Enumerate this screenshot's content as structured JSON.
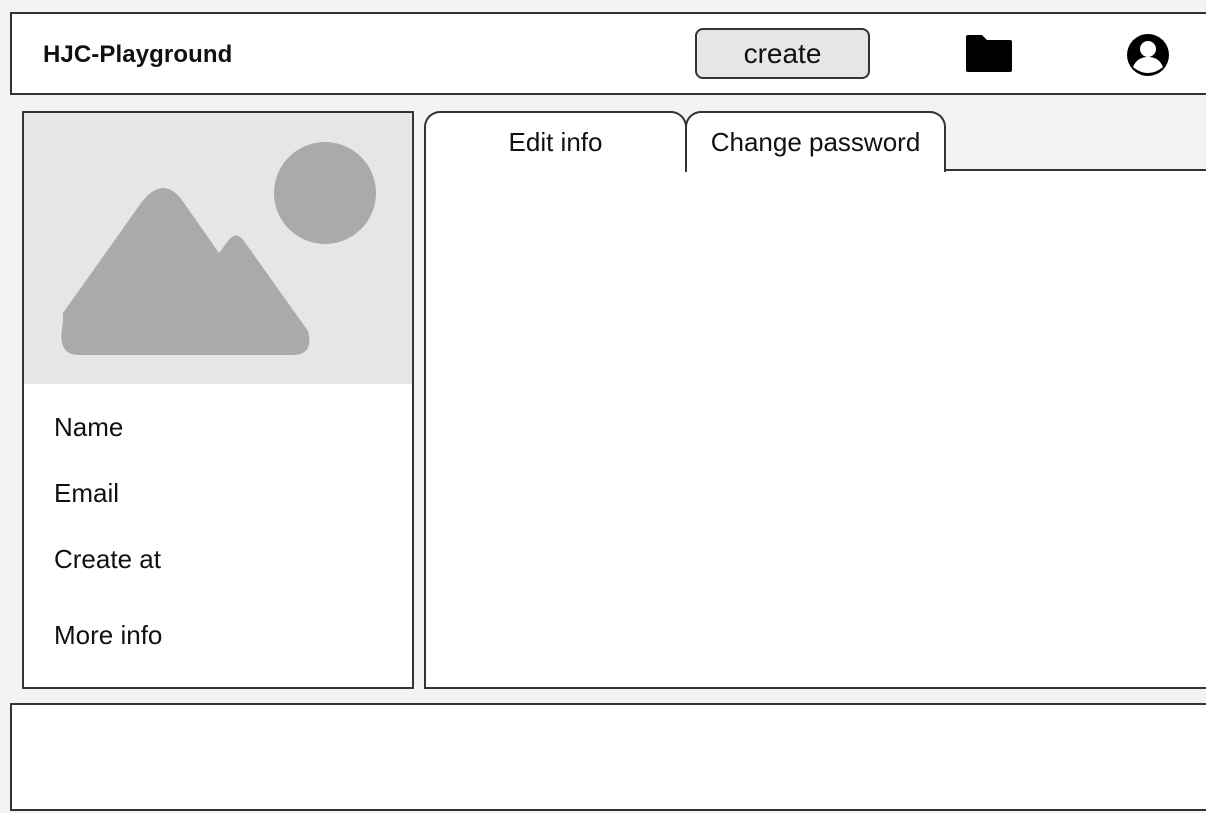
{
  "header": {
    "title": "HJC-Playground",
    "create_label": "create",
    "icons": {
      "folder": "folder-icon",
      "user": "user-circle-icon"
    }
  },
  "profile": {
    "image": "image-placeholder-icon",
    "fields": {
      "name": "Name",
      "email": "Email",
      "created": "Create at",
      "more": "More info"
    }
  },
  "tabs": [
    {
      "label": "Edit info"
    },
    {
      "label": "Change password"
    }
  ],
  "colors": {
    "border": "#333333",
    "button_bg": "#e6e6e6",
    "placeholder_bg": "#e6e6e6",
    "placeholder_shape": "#aaaaaa"
  }
}
